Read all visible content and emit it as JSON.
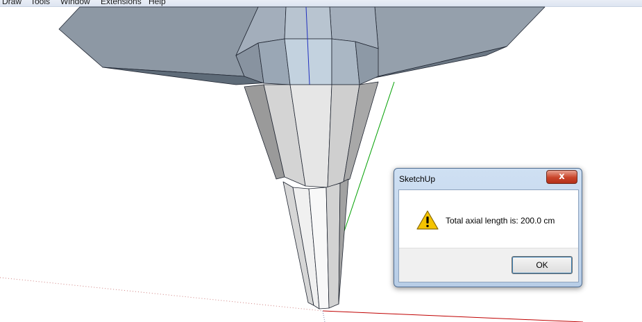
{
  "menubar": {
    "items": [
      "Draw",
      "Tools",
      "Window",
      "Extensions",
      "Help"
    ]
  },
  "dialog": {
    "title": "SketchUp",
    "close_symbol": "x",
    "icon": "warning-icon",
    "message": "Total axial length is: 200.0 cm",
    "ok_label": "OK"
  },
  "colors": {
    "axis_red": "#c00000",
    "axis_green": "#00a000",
    "axis_blue": "#0000c0",
    "close_button": "#c9442a"
  }
}
